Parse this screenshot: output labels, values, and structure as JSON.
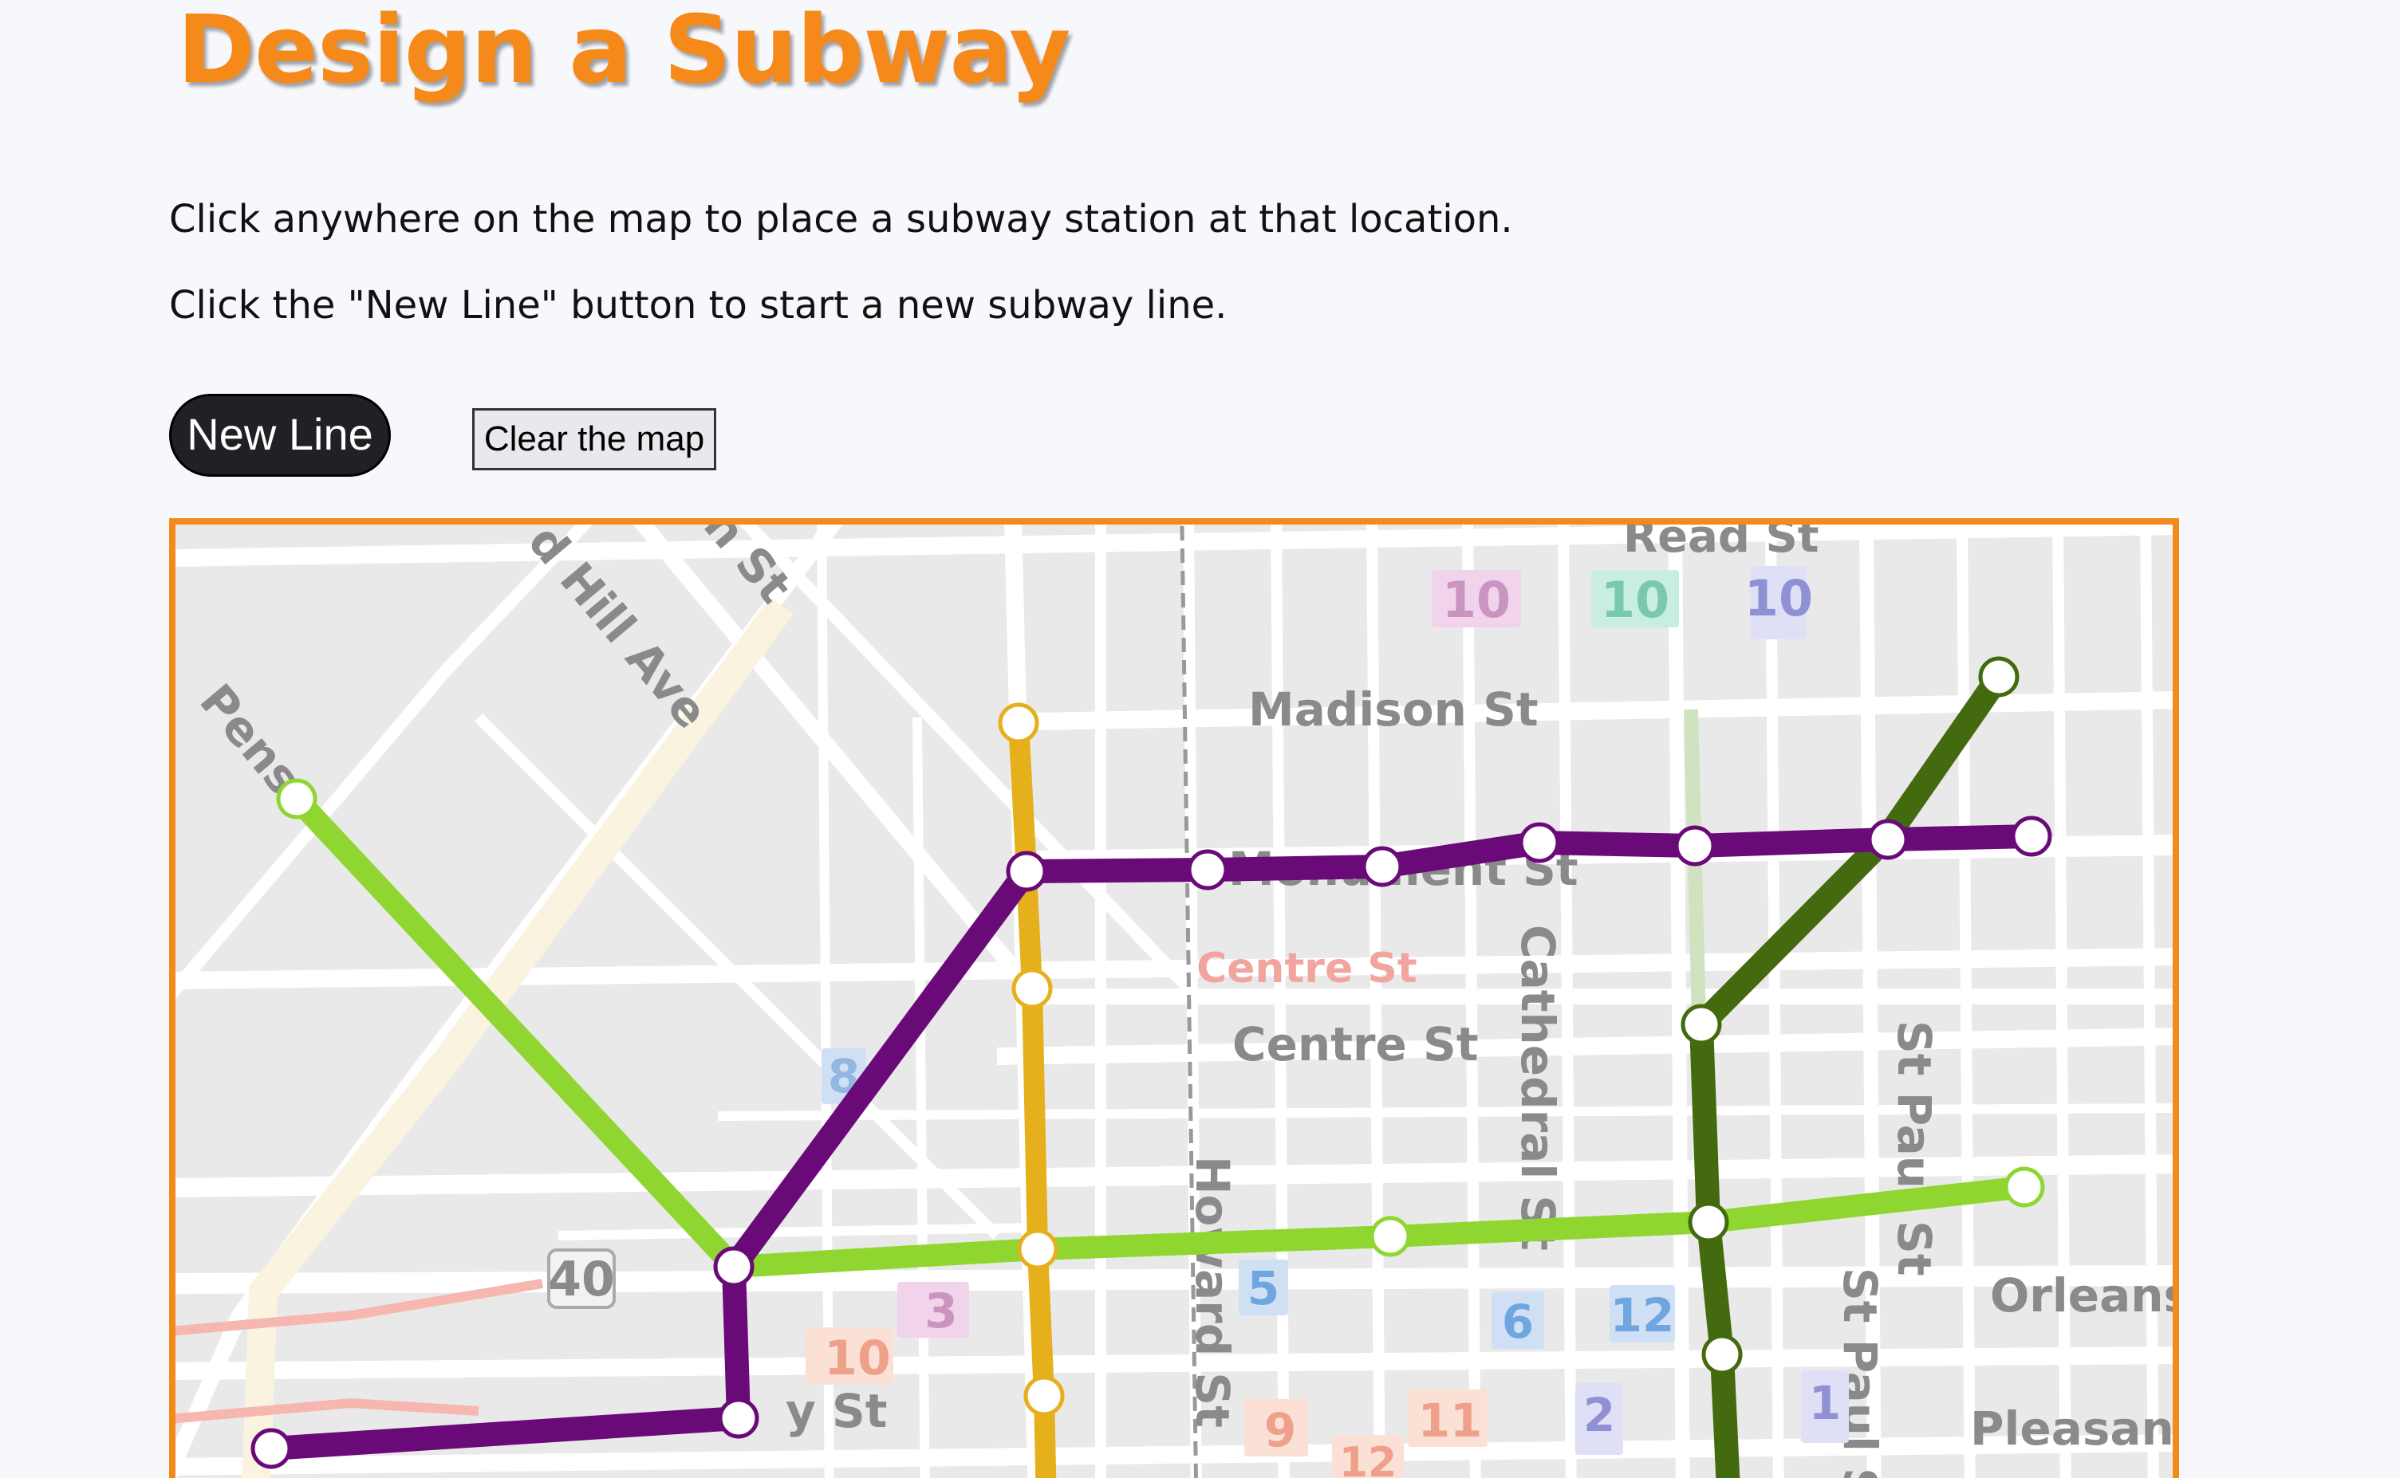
{
  "header": {
    "title": "Design a Subway"
  },
  "instructions": {
    "line1": "Click anywhere on the map to place a subway station at that location.",
    "line2": "Click the \"New Line\" button to start a new subway line."
  },
  "controls": {
    "new_line_label": "New Line",
    "clear_label": "Clear the map"
  },
  "colors": {
    "title": "#f5891a",
    "map_border": "#f28b1c",
    "line_purple": "#6a0a78",
    "line_lightgreen": "#8fd630",
    "line_darkgreen": "#436a0e",
    "line_gold": "#e5b01c",
    "station_fill": "#ffffff"
  },
  "map": {
    "street_labels": {
      "read": "Read St",
      "madison": "Madison St",
      "monument": "Monument St",
      "centre_upper": "Centre St",
      "centre": "Centre St",
      "cathedral": "Cathedral St",
      "st_paul": "St Paul St",
      "st_paul_2": "St Paul St",
      "orleans": "Orleans",
      "pleasant": "Pleasant",
      "howard": "Howard St",
      "hill": "d Hill Ave",
      "n_st": "n St",
      "pens": "Pens",
      "mulberry": "y St",
      "route": "40"
    },
    "poi_badges": [
      "10",
      "10",
      "10",
      "8",
      "3",
      "10",
      "5",
      "6",
      "12",
      "2",
      "1",
      "9",
      "11",
      "12"
    ]
  },
  "subway_lines": [
    {
      "name": "",
      "color": "purple",
      "station_count": 10
    },
    {
      "name": "",
      "color": "light-green",
      "station_count": 6
    },
    {
      "name": "",
      "color": "dark-green",
      "station_count": 5
    },
    {
      "name": "",
      "color": "gold",
      "station_count": 4
    }
  ]
}
